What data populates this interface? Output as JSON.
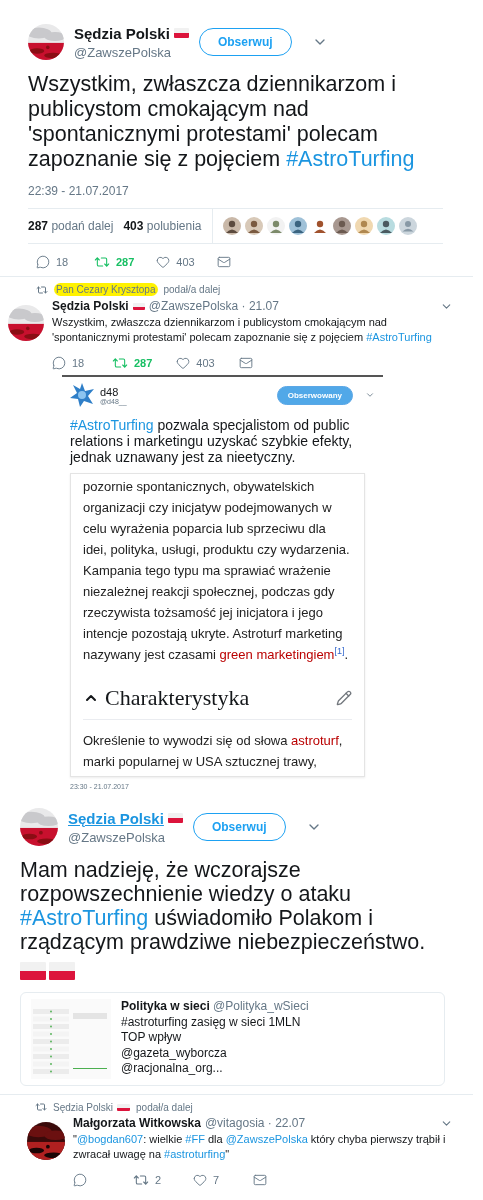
{
  "main_tweet": {
    "author": {
      "name": "Sędzia Polski",
      "handle": "@ZawszePolska",
      "flag": true,
      "hovered": false
    },
    "follow_button": {
      "label": "Obserwuj",
      "following": false
    },
    "text": [
      {
        "kind": "plain",
        "text": "Wszystkim, zwłaszcza dziennikarzom i publicystom cmokającym nad 'spontanicznymi protestami' polecam zapoznanie się z pojęciem "
      },
      {
        "kind": "hashtag",
        "text": "#AstroTurfing"
      }
    ],
    "timestamp": "22:39 - 21.07.2017",
    "stats": [
      {
        "count": "287",
        "label": "podań dalej"
      },
      {
        "count": "403",
        "label": "polubienia"
      }
    ],
    "likers": [
      {
        "kind": "picture"
      },
      {
        "kind": "picture"
      },
      {
        "kind": "picture"
      },
      {
        "kind": "picture"
      },
      {
        "kind": "picture"
      },
      {
        "kind": "picture"
      },
      {
        "kind": "picture"
      },
      {
        "kind": "picture"
      },
      {
        "kind": "default"
      }
    ],
    "actions": {
      "replies": "18",
      "retweets": "287",
      "likes": "403",
      "retweeted": true
    }
  },
  "retweet": {
    "retweeted_by": {
      "name": "Pan Cezary Krysztopa",
      "flag": false,
      "highlighted": true
    },
    "retweet_label": "podał/a dalej",
    "author": {
      "name": "Sędzia Polski",
      "flag": true,
      "meta": "@ZawszePolska · 21.07"
    },
    "text": [
      {
        "kind": "plain",
        "text": "Wszystkim, zwłaszcza dziennikarzom i publicystom cmokającym nad 'spontanicznymi protestami' polecam zapoznanie się z pojęciem "
      },
      {
        "kind": "hashtag",
        "text": "#AstroTurfing"
      }
    ],
    "actions": {
      "replies": "18",
      "retweets": "287",
      "likes": "403",
      "retweeted": true
    }
  },
  "embedded_screenshot": {
    "author": {
      "name": "d48",
      "handle": "@d48__"
    },
    "follow_button": {
      "label": "Obserwowany",
      "following": true
    },
    "text": [
      {
        "kind": "hashtag",
        "text": "#AstroTurfing"
      },
      {
        "kind": "plain",
        "text": " pozwala specjalistom od public relations i marketingu uzyskać szybkie efekty, jednak uznawany jest za nieetyczny."
      }
    ],
    "article": {
      "intro": [
        {
          "kind": "plain",
          "text": "pozornie spontanicznych, obywatelskich organizacji czy inicjatyw podejmowanych w celu wyrażenia poparcia lub sprzeciwu dla idei, polityka, usługi, produktu czy wydarzenia. Kampania tego typu ma sprawiać wrażenie niezależnej reakcji społecznej, podczas gdy rzeczywista tożsamość jej inicjatora i jego intencje pozostają ukryte. Astroturf marketing nazywany jest czasami "
        },
        {
          "kind": "wikilink",
          "text": "green marketingiem"
        },
        {
          "kind": "ref",
          "text": "[1]"
        },
        {
          "kind": "plain",
          "text": "."
        }
      ],
      "section_title": "Charakterystyka",
      "expanded": true,
      "section_text": [
        {
          "kind": "plain",
          "text": "Określenie to wywodzi się od słowa "
        },
        {
          "kind": "wikilink",
          "text": "astroturf"
        },
        {
          "kind": "plain",
          "text": ", marki popularnej w USA sztucznej trawy,"
        }
      ]
    },
    "timestamp": "23:30 - 21.07.2017"
  },
  "second_tweet": {
    "author": {
      "name": "Sędzia Polski",
      "handle": "@ZawszePolska",
      "flag": true,
      "hovered": true
    },
    "follow_button": {
      "label": "Obserwuj",
      "following": false
    },
    "text": [
      {
        "kind": "plain",
        "text": "Mam nadzieję, że wczorajsze rozpowszechnienie wiedzy o ataku "
      },
      {
        "kind": "hashtag",
        "text": "#AstroTurfing"
      },
      {
        "kind": "plain",
        "text": " uświadomiło Polakom i rządzącym prawdziwe niebezpieczeństwo."
      }
    ],
    "emoji_flags": [
      {
        "kind": "flag"
      },
      {
        "kind": "flag"
      }
    ],
    "quote": {
      "name": "Polityka w sieci",
      "handle": "@Polityka_wSieci",
      "lines": [
        "#astroturfing zasięg w sieci 1MLN",
        "TOP wpływ",
        "@gazeta_wyborcza",
        "@racjonalna_org..."
      ]
    }
  },
  "retweet_2": {
    "retweeted_by": {
      "name": "Sędzia Polski",
      "flag": true,
      "highlighted": false
    },
    "retweet_label": "podał/a dalej",
    "author": {
      "name": "Małgorzata Witkowska",
      "flag": false,
      "meta": "@vitagosia · 22.07"
    },
    "text": [
      {
        "kind": "plain",
        "text": "\""
      },
      {
        "kind": "mention",
        "text": "@bogdan607"
      },
      {
        "kind": "plain",
        "text": ": wielkie "
      },
      {
        "kind": "hashtag",
        "text": "#FF"
      },
      {
        "kind": "plain",
        "text": " dla "
      },
      {
        "kind": "mention",
        "text": "@ZawszePolska"
      },
      {
        "kind": "plain",
        "text": " który chyba pierwszy trąbił i zwracał uwagę na "
      },
      {
        "kind": "hashtag",
        "text": "#astroturfing"
      },
      {
        "kind": "plain",
        "text": "\""
      }
    ],
    "actions": {
      "retweets": "2",
      "likes": "7",
      "retweeted": false
    }
  }
}
